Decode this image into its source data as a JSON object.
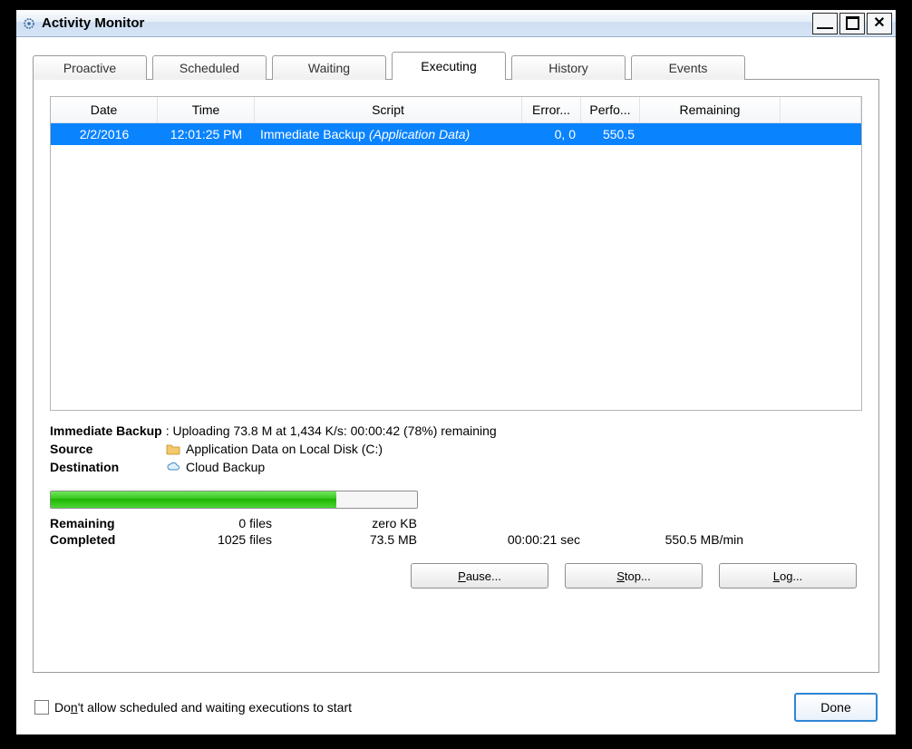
{
  "window_title": "Activity Monitor",
  "tabs": [
    {
      "label": "Proactive"
    },
    {
      "label": "Scheduled"
    },
    {
      "label": "Waiting"
    },
    {
      "label": "Executing"
    },
    {
      "label": "History"
    },
    {
      "label": "Events"
    }
  ],
  "active_tab_index": 3,
  "columns": {
    "date": "Date",
    "time": "Time",
    "script": "Script",
    "errors": "Error...",
    "performance": "Perfo...",
    "remaining": "Remaining"
  },
  "rows": [
    {
      "date": "2/2/2016",
      "time": "12:01:25 PM",
      "script_main": "Immediate Backup",
      "script_sub": "(Application Data)",
      "errors": "0, 0",
      "performance": "550.5",
      "remaining": ""
    }
  ],
  "status": {
    "title_label": "Immediate Backup",
    "title_body": ": Uploading 73.8 M at 1,434 K/s: 00:00:42 (78%) remaining",
    "source_label": "Source",
    "source_value": "Application Data on Local Disk (C:)",
    "dest_label": "Destination",
    "dest_value": "Cloud Backup"
  },
  "progress_pct": 78,
  "stats": {
    "remaining": {
      "label": "Remaining",
      "files": "0 files",
      "size": "zero KB",
      "elapsed": "",
      "rate": ""
    },
    "completed": {
      "label": "Completed",
      "files": "1025 files",
      "size": "73.5 MB",
      "elapsed": "00:00:21 sec",
      "rate": "550.5 MB/min"
    }
  },
  "action_buttons": {
    "pause": "Pause...",
    "stop": "Stop...",
    "log": "Log..."
  },
  "footer": {
    "checkbox_label": "Don't allow scheduled and waiting executions to start",
    "done_label": "Done"
  }
}
